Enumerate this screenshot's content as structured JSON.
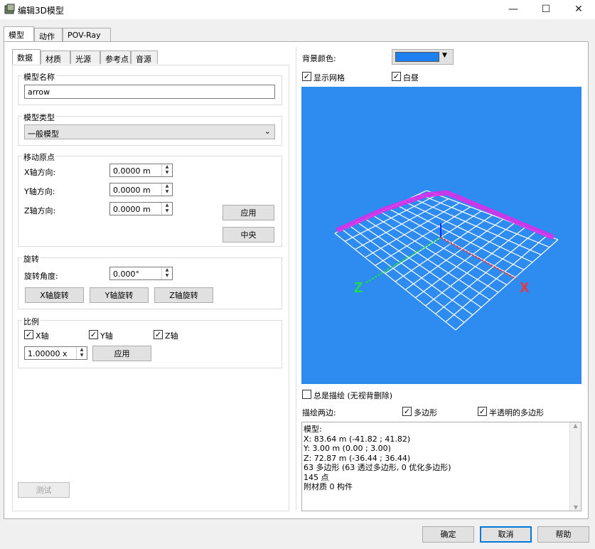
{
  "window": {
    "title": "编辑3D模型",
    "minimize": "—",
    "maximize": "☐",
    "close": "✕"
  },
  "main_tabs": [
    "模型",
    "动作",
    "POV-Ray"
  ],
  "sub_tabs": [
    "数据",
    "材质",
    "光源",
    "参考点",
    "音源"
  ],
  "model_name": {
    "label": "模型名称",
    "value": "arrow"
  },
  "model_type": {
    "label": "模型类型",
    "value": "一般模型"
  },
  "move_origin": {
    "label": "移动原点",
    "x_label": "X轴方向:",
    "x_value": "0.0000 m",
    "y_label": "Y轴方向:",
    "y_value": "0.0000 m",
    "z_label": "Z轴方向:",
    "z_value": "0.0000 m",
    "apply": "应用",
    "center": "中央"
  },
  "rotate": {
    "label": "旋转",
    "angle_label": "旋转角度:",
    "angle_value": "0.000°",
    "x_button": "X轴旋转",
    "y_button": "Y轴旋转",
    "z_button": "Z轴旋转"
  },
  "scale": {
    "label": "比例",
    "x_axis": "X轴",
    "y_axis": "Y轴",
    "z_axis": "Z轴",
    "value": "1.00000 x",
    "apply": "应用"
  },
  "test_button": "测试",
  "background": {
    "label": "背景颜色:",
    "color": "#1e80f0"
  },
  "show_grid": "显示网格",
  "white_display": "白昼",
  "viewport": {
    "bg": "#2e8cf0",
    "axis_x_label": "X",
    "axis_z_label": "Z"
  },
  "always_draw": "总是描绘 (无视背删除)",
  "draw_both": "描绘两边:",
  "polygon": "多边形",
  "transparent_polygon": "半透明的多边形",
  "info_lines": [
    "模型:",
    "X: 83.64 m (-41.82 ; 41.82)",
    "Y: 3.00 m (0.00 ; 3.00)",
    "Z: 72.87 m (-36.44 ; 36.44)",
    "63 多边形 (63 透过多边形, 0 优化多边形)",
    "145 点",
    "附材质 0 构件"
  ],
  "footer": {
    "ok": "确定",
    "cancel": "取消",
    "help": "帮助"
  }
}
